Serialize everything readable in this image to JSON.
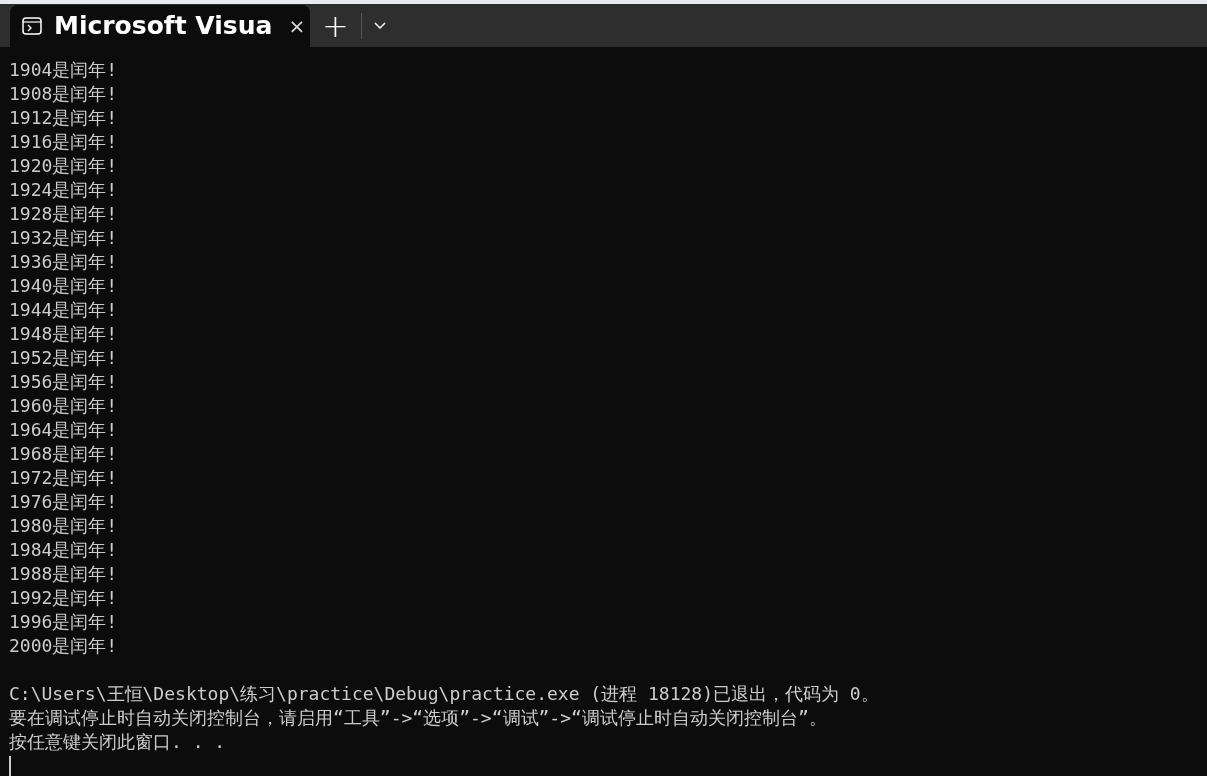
{
  "tabs": [
    {
      "title": "Microsoft Visua",
      "selected": true,
      "close": "×"
    }
  ],
  "new_tab": "+",
  "output": [
    "1904是闰年!",
    "1908是闰年!",
    "1912是闰年!",
    "1916是闰年!",
    "1920是闰年!",
    "1924是闰年!",
    "1928是闰年!",
    "1932是闰年!",
    "1936是闰年!",
    "1940是闰年!",
    "1944是闰年!",
    "1948是闰年!",
    "1952是闰年!",
    "1956是闰年!",
    "1960是闰年!",
    "1964是闰年!",
    "1968是闰年!",
    "1972是闰年!",
    "1976是闰年!",
    "1980是闰年!",
    "1984是闰年!",
    "1988是闰年!",
    "1992是闰年!",
    "1996是闰年!",
    "2000是闰年!"
  ],
  "messages": [
    "C:\\Users\\王恒\\Desktop\\练习\\practice\\Debug\\practice.exe (进程 18128)已退出，代码为 0。",
    "要在调试停止时自动关闭控制台，请启用“工具”->“选项”->“调试”->“调试停止时自动关闭控制台”。",
    "按任意键关闭此窗口. . ."
  ]
}
